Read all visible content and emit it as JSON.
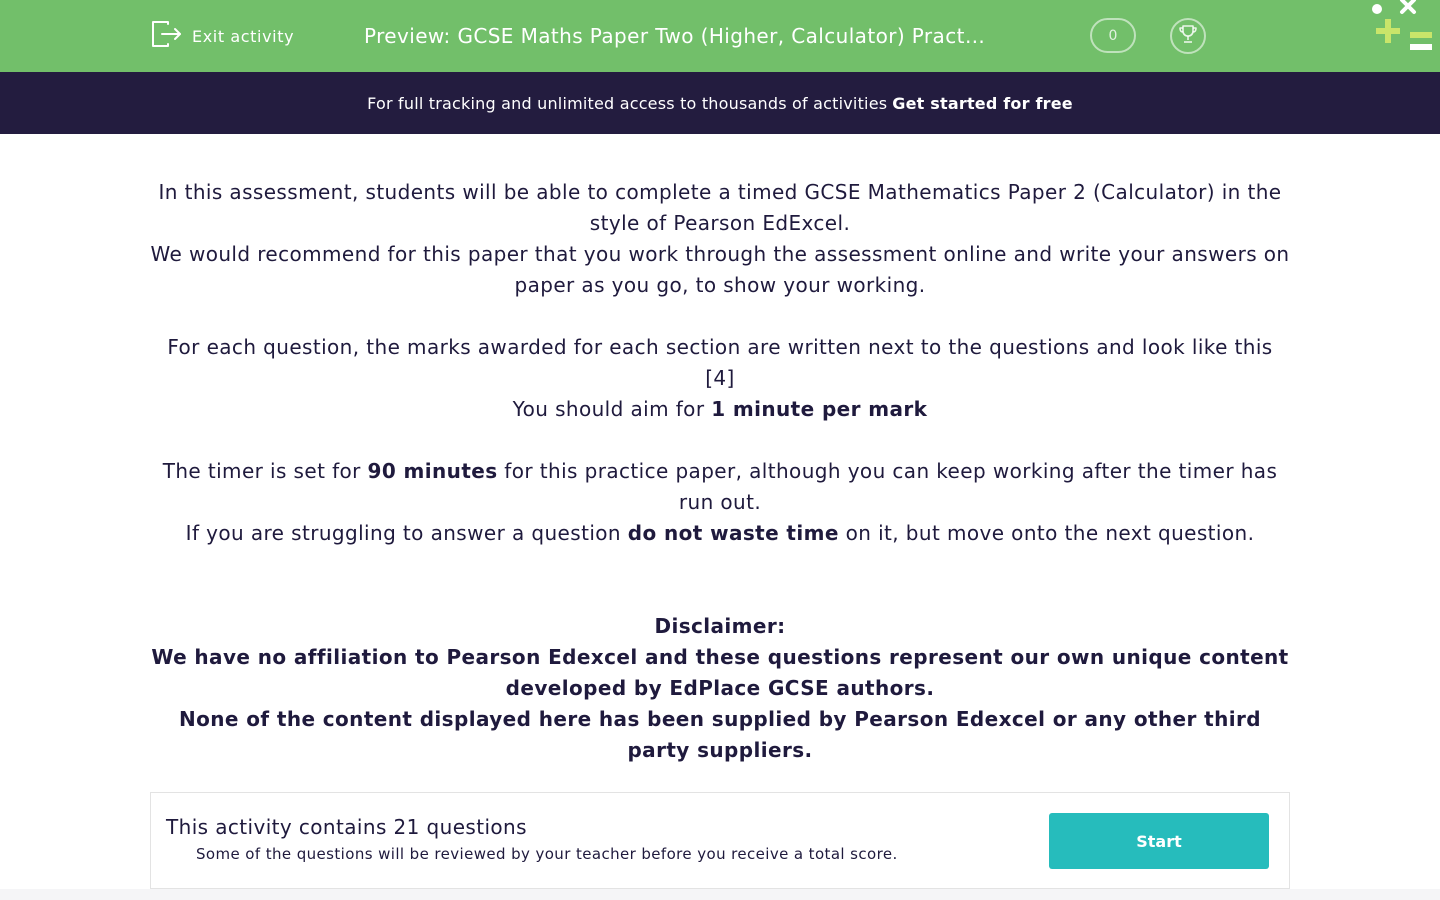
{
  "header": {
    "exit_label": "Exit activity",
    "title": "Preview: GCSE Maths Paper Two (Higher, Calculator) Practice Paper",
    "score": "0",
    "colors": {
      "topbar": "#72bf6a",
      "promo": "#231c3f",
      "accent": "#26bcbc"
    }
  },
  "promo": {
    "text": "For full tracking and unlimited access to thousands of activities",
    "link": "Get started for free"
  },
  "intro": {
    "p1": "In this assessment, students will be able to complete a timed GCSE Mathematics Paper 2 (Calculator) in the style of Pearson EdExcel.",
    "p2": "We would recommend for this paper that you work through the assessment online and write your answers on paper as you go, to show your working.",
    "p3": "For each question, the marks awarded for each section are written next to the questions and look like this [4]",
    "p4_pre": "You should aim for ",
    "p4_bold": "1 minute per mark",
    "p5_pre": "The timer is set for ",
    "p5_bold": "90 minutes",
    "p5_post": " for this practice paper, although you can keep working after the timer has run out.",
    "p6_pre": "If you are struggling to answer a question ",
    "p6_bold": "do not waste time",
    "p6_post": " on it, but move onto the next question."
  },
  "disclaimer": {
    "heading": "Disclaimer:",
    "line1": "We have no affiliation to Pearson Edexcel and these questions represent our own unique content developed by EdPlace GCSE authors.",
    "line2": "None of the content displayed here has been supplied by Pearson Edexcel or any other third party suppliers."
  },
  "card": {
    "title": "This activity contains 21 questions",
    "subtitle": "Some of the questions will be reviewed by your teacher before you receive a total score.",
    "start_label": "Start"
  }
}
